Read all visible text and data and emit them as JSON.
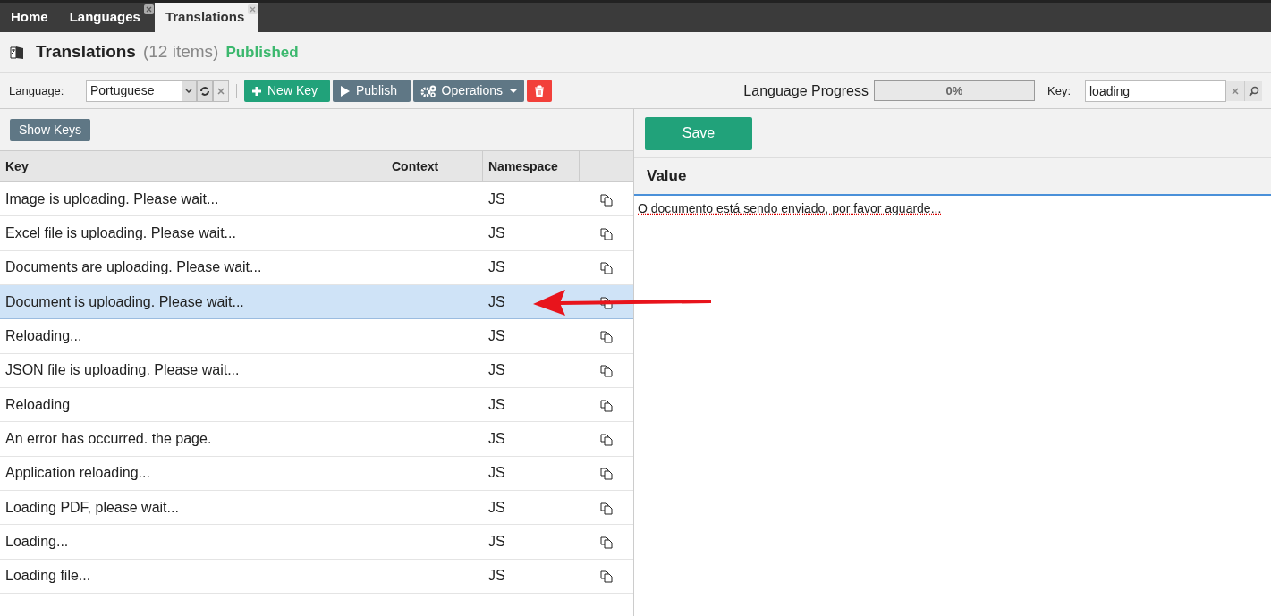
{
  "tabs": [
    {
      "label": "Home",
      "selected": false,
      "closable": false
    },
    {
      "label": "Languages",
      "selected": false,
      "closable": true
    },
    {
      "label": "Translations",
      "selected": true,
      "closable": true
    }
  ],
  "header": {
    "title": "Translations",
    "count": "(12 items)",
    "status": "Published"
  },
  "toolbar": {
    "language_label": "Language:",
    "language": "Portuguese",
    "buttons": [
      {
        "kind": "new",
        "label": "New Key"
      },
      {
        "kind": "publish",
        "label": "Publish"
      },
      {
        "kind": "operations",
        "label": "Operations"
      },
      {
        "kind": "delete"
      }
    ],
    "progress_label": "Language Progress",
    "progress": {
      "level": 0,
      "reading": "0%"
    },
    "key_label": "Key:",
    "key_value": "loading"
  },
  "show_keys": "Show Keys",
  "table": {
    "columns": [
      "Key",
      "Context",
      "Namespace"
    ],
    "rows": [
      {
        "key": "Image is uploading. Please wait...",
        "namespace": "JS",
        "selected": false
      },
      {
        "key": "Excel file is uploading. Please wait...",
        "namespace": "JS",
        "selected": false
      },
      {
        "key": "Documents are uploading. Please wait...",
        "namespace": "JS",
        "selected": false
      },
      {
        "key": "Document is uploading. Please wait...",
        "namespace": "JS",
        "selected": true
      },
      {
        "key": "Reloading...",
        "namespace": "JS",
        "selected": false
      },
      {
        "key": "JSON file is uploading. Please wait...",
        "namespace": "JS",
        "selected": false
      },
      {
        "key": "Reloading",
        "namespace": "JS",
        "selected": false
      },
      {
        "key": "An error has occurred. the page.",
        "namespace": "JS",
        "selected": false
      },
      {
        "key": "Application reloading...",
        "namespace": "JS",
        "selected": false
      },
      {
        "key": "Loading PDF, please wait...",
        "namespace": "JS",
        "selected": false
      },
      {
        "key": "Loading...",
        "namespace": "JS",
        "selected": false
      },
      {
        "key": "Loading file...",
        "namespace": "JS",
        "selected": false
      }
    ]
  },
  "editor": {
    "save": "Save",
    "value_heading": "Value",
    "value": "O documento está sendo enviado, por favor aguarde..."
  }
}
